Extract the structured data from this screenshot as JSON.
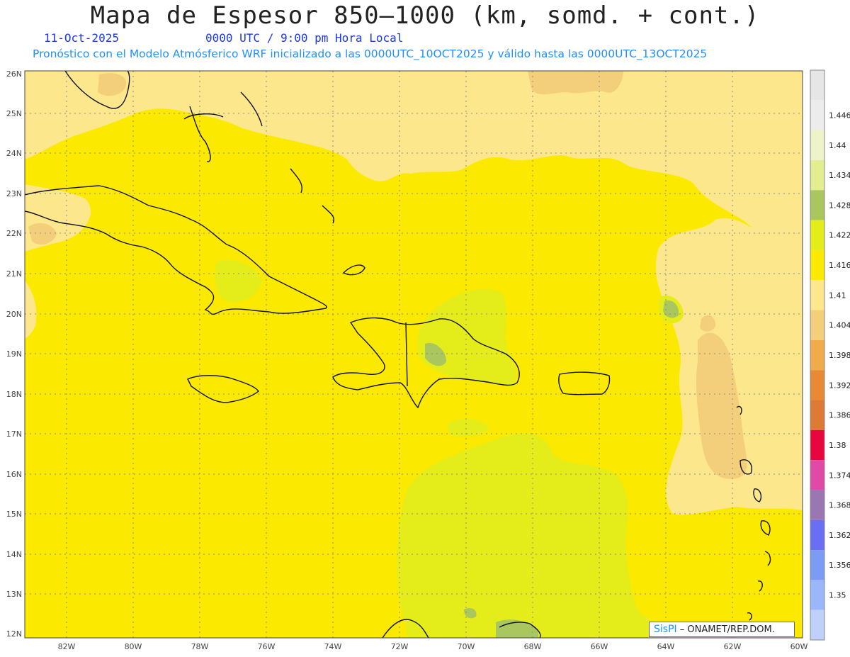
{
  "header": {
    "title": "Mapa de Espesor 850–1000 (km, somd. + cont.)",
    "date": "11-Oct-2025",
    "time": "0000 UTC / 9:00 pm Hora Local",
    "forecast_note": "Pronóstico con el Modelo Atmósferico WRF inicializado a las 0000UTC_10OCT2025 y válido hasta las  0000UTC_13OCT2025"
  },
  "map": {
    "lat_labels": [
      "26N",
      "25N",
      "24N",
      "23N",
      "22N",
      "21N",
      "20N",
      "19N",
      "18N",
      "17N",
      "16N",
      "15N",
      "14N",
      "13N",
      "12N"
    ],
    "lon_labels": [
      "82W",
      "80W",
      "78W",
      "76W",
      "74W",
      "72W",
      "70W",
      "68W",
      "66W",
      "64W",
      "62W",
      "60W"
    ]
  },
  "colorbar": {
    "levels": [
      {
        "label": "1.446",
        "color": "#ececec"
      },
      {
        "label": "1.44",
        "color": "#eef3c8"
      },
      {
        "label": "1.434",
        "color": "#e2ee90"
      },
      {
        "label": "1.428",
        "color": "#a9c65f"
      },
      {
        "label": "1.422",
        "color": "#e4ec1a"
      },
      {
        "label": "1.416",
        "color": "#fbea00"
      },
      {
        "label": "1.41",
        "color": "#fde78c"
      },
      {
        "label": "1.404",
        "color": "#f3cf7b"
      },
      {
        "label": "1.398",
        "color": "#f0ab4a"
      },
      {
        "label": "1.392",
        "color": "#e88a33"
      },
      {
        "label": "1.386",
        "color": "#dd7b36"
      },
      {
        "label": "1.38",
        "color": "#e8063f"
      },
      {
        "label": "1.374",
        "color": "#e04aa6"
      },
      {
        "label": "1.368",
        "color": "#9a76b3"
      },
      {
        "label": "1.362",
        "color": "#6a6ef2"
      },
      {
        "label": "1.356",
        "color": "#7c9bf5"
      },
      {
        "label": "1.35",
        "color": "#99b7fa"
      },
      {
        "label": "",
        "color": "#bfd0fa"
      }
    ]
  },
  "credit": {
    "logo": "SisPI",
    "text": "–  ONAMET/REP.DOM."
  }
}
